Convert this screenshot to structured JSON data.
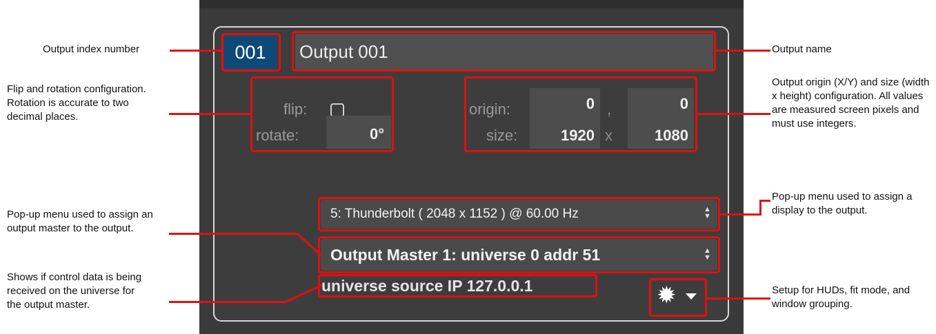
{
  "annotations": {
    "index_number": "Output index number",
    "flip_rotation": "Flip and rotation configuration. Rotation is accurate to two decimal places.",
    "output_master_menu": "Pop-up menu used to assign an output master to the output.",
    "control_data": "Shows if control data is being received on the universe for the output master.",
    "output_name": "Output name",
    "origin_size": "Output origin (X/Y) and size (width x height) configuration. All values are measured screen pixels and must use integers.",
    "display_menu": "Pop-up menu used to assign a display to the output.",
    "setup_menu": "Setup for HUDs, fit mode, and window grouping."
  },
  "panel": {
    "index": "001",
    "name": "Output 001",
    "flip_label": "flip:",
    "flip_checked": false,
    "rotate_label": "rotate:",
    "rotate_value": "0°",
    "origin_label": "origin:",
    "origin_x": "0",
    "origin_sep": ",",
    "origin_y": "0",
    "size_label": "size:",
    "size_w": "1920",
    "size_sep": "x",
    "size_h": "1080",
    "display_selected": "5: Thunderbolt ( 2048 x 1152 ) @ 60.00 Hz",
    "master_selected": "Output Master 1: universe 0 addr 51",
    "source_ip": "universe source IP 127.0.0.1",
    "setup_icon": "gear-icon"
  },
  "colors": {
    "highlight": "#e01010",
    "index_bg": "#0e4a78",
    "panel_bg": "#3a3a3a"
  }
}
